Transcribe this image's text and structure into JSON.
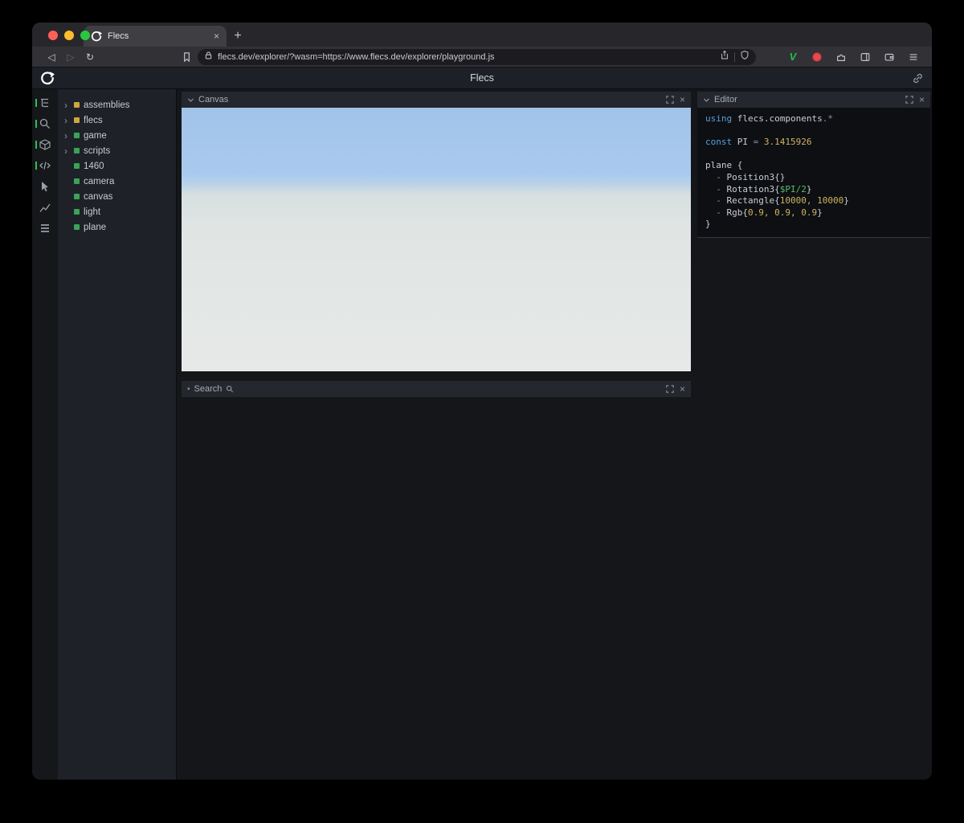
{
  "glyphs": {
    "close": "×",
    "new_tab": "+",
    "back": "◁",
    "forward": "▷",
    "reload": "↻",
    "brave_v": "V"
  },
  "browser": {
    "tab_title": "Flecs",
    "url": "flecs.dev/explorer/?wasm=https://www.flecs.dev/explorer/playground.js"
  },
  "app": {
    "header": {
      "title": "Flecs"
    },
    "sidebar_icons": [
      {
        "name": "entity-tree-icon"
      },
      {
        "name": "search-icon"
      },
      {
        "name": "entities-cube-icon"
      },
      {
        "name": "code-icon"
      },
      {
        "name": "inspector-icon"
      },
      {
        "name": "stats-icon"
      },
      {
        "name": "rows-icon"
      }
    ],
    "tree": {
      "items": [
        {
          "label": "assemblies",
          "kind": "module",
          "expand": "expandable"
        },
        {
          "label": "flecs",
          "kind": "module",
          "expand": "expandable"
        },
        {
          "label": "game",
          "kind": "entity",
          "expand": "expandable"
        },
        {
          "label": "scripts",
          "kind": "entity",
          "expand": "expandable"
        },
        {
          "label": "1460",
          "kind": "entity"
        },
        {
          "label": "camera",
          "kind": "entity"
        },
        {
          "label": "canvas",
          "kind": "entity"
        },
        {
          "label": "light",
          "kind": "entity"
        },
        {
          "label": "plane",
          "kind": "entity"
        }
      ]
    },
    "panels": {
      "canvas": {
        "title": "Canvas"
      },
      "search": {
        "title": "Search"
      },
      "editor": {
        "title": "Editor",
        "lines": [
          [
            {
              "t": "using ",
              "c": "kw"
            },
            {
              "t": "flecs.components",
              "c": "plain"
            },
            {
              "t": ".*",
              "c": "punct"
            }
          ],
          [],
          [
            {
              "t": "const ",
              "c": "kw"
            },
            {
              "t": "PI",
              "c": "plain"
            },
            {
              "t": " = ",
              "c": "punct"
            },
            {
              "t": "3.1415926",
              "c": "num"
            }
          ],
          [],
          [
            {
              "t": "plane {",
              "c": "plain"
            }
          ],
          [
            {
              "t": "  - ",
              "c": "punct"
            },
            {
              "t": "Position3{}",
              "c": "plain"
            }
          ],
          [
            {
              "t": "  - ",
              "c": "punct"
            },
            {
              "t": "Rotation3{",
              "c": "plain"
            },
            {
              "t": "$PI/2",
              "c": "var"
            },
            {
              "t": "}",
              "c": "plain"
            }
          ],
          [
            {
              "t": "  - ",
              "c": "punct"
            },
            {
              "t": "Rectangle{",
              "c": "plain"
            },
            {
              "t": "10000, 10000",
              "c": "num"
            },
            {
              "t": "}",
              "c": "plain"
            }
          ],
          [
            {
              "t": "  - ",
              "c": "punct"
            },
            {
              "t": "Rgb{",
              "c": "plain"
            },
            {
              "t": "0.9, 0.9, 0.9",
              "c": "num"
            },
            {
              "t": "}",
              "c": "plain"
            }
          ],
          [
            {
              "t": "}",
              "c": "plain"
            }
          ]
        ]
      }
    }
  },
  "colors": {
    "accent_green": "#2fbf4f",
    "module_yellow": "#d0a63d",
    "entity_green": "#3aa357",
    "keyword_blue": "#5b9fd8",
    "number_yellow": "#cfb45e",
    "variable_green": "#58bd68",
    "sky_blue": "#a6c8ec",
    "ground_white": "#e3e8e6"
  }
}
